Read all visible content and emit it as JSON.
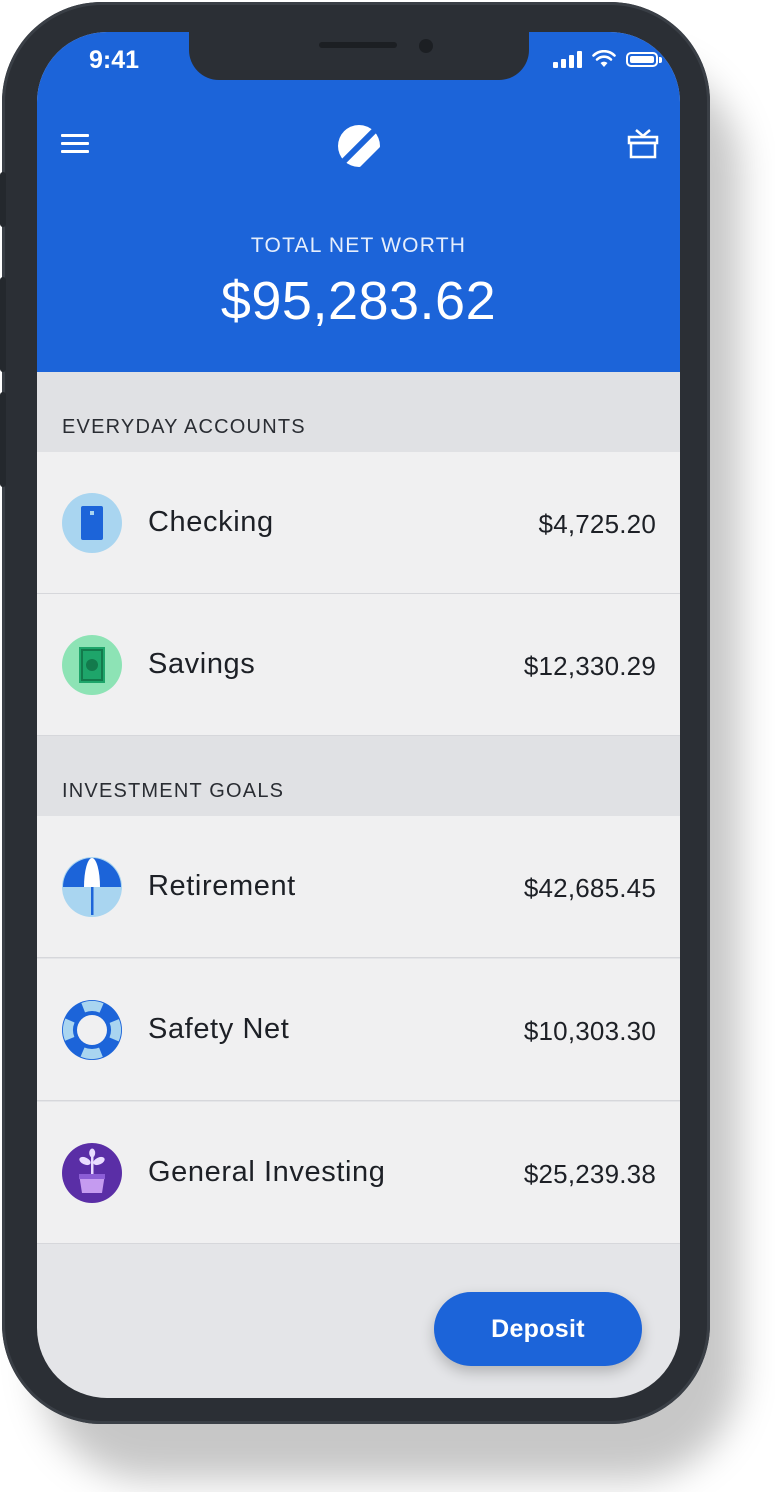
{
  "status_bar": {
    "time": "9:41"
  },
  "header": {
    "net_worth_label": "TOTAL NET WORTH",
    "net_worth_value": "$95,283.62",
    "color": "#1c64d9"
  },
  "sections": [
    {
      "title": "EVERYDAY ACCOUNTS",
      "accounts": [
        {
          "name": "Checking",
          "amount": "$4,725.20",
          "icon": "card-icon"
        },
        {
          "name": "Savings",
          "amount": "$12,330.29",
          "icon": "cash-icon"
        }
      ]
    },
    {
      "title": "INVESTMENT GOALS",
      "accounts": [
        {
          "name": "Retirement",
          "amount": "$42,685.45",
          "icon": "umbrella-icon"
        },
        {
          "name": "Safety Net",
          "amount": "$10,303.30",
          "icon": "life-ring-icon"
        },
        {
          "name": "General Investing",
          "amount": "$25,239.38",
          "icon": "plant-icon"
        }
      ]
    }
  ],
  "deposit_label": "Deposit"
}
